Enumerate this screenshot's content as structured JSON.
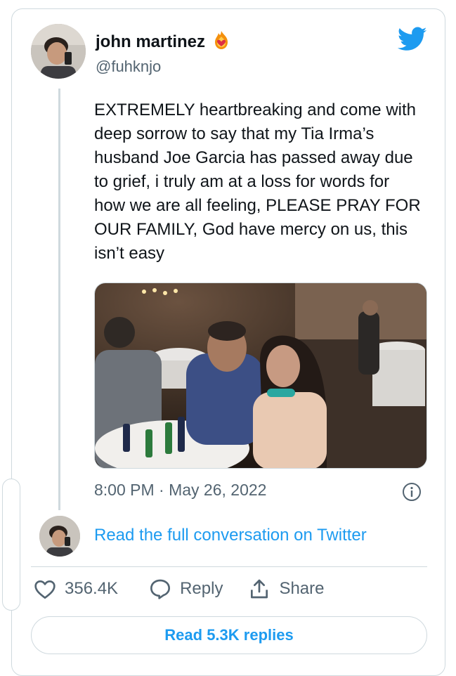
{
  "user": {
    "display_name": "john martinez",
    "handle": "@fuhknjo",
    "badge_icon": "fire-heart-emoji-icon"
  },
  "tweet": {
    "text": "EXTREMELY heartbreaking and come with\ndeep sorrow to say that my Tia Irma’s\nhusband Joe Garcia has passed away due\nto grief, i truly am at a loss for words for\nhow we are all feeling, PLEASE PRAY FOR\nOUR FAMILY, God have mercy on us, this\nisn’t easy",
    "timestamp": "8:00 PM · May 26, 2022"
  },
  "conversation_link": "Read the full conversation on Twitter",
  "actions": {
    "likes": "356.4K",
    "reply": "Reply",
    "share": "Share"
  },
  "replies_button": "Read 5.3K replies",
  "colors": {
    "accent": "#1d9bf0",
    "text": "#0f1419",
    "muted": "#536471",
    "border": "#cfd9de"
  }
}
